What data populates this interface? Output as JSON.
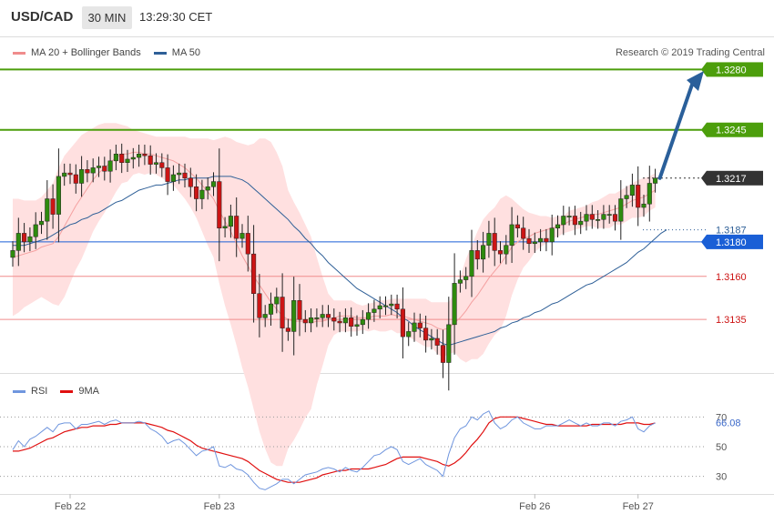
{
  "header": {
    "symbol": "USD/CAD",
    "timeframe": "30 MIN",
    "time": "13:29:30 CET"
  },
  "copyright": "Research © 2019 Trading Central",
  "colors": {
    "resistance": "#4c9e0c",
    "support_line": "#f08c8c",
    "ma50": "#2e5f97",
    "band_fill": "#ffe0e0",
    "ma20": "#f4a0a0",
    "bull_candle": "#2e8b0e",
    "bear_candle": "#cc1515",
    "rsi": "#7096de",
    "rsi_ma": "#e01010",
    "arrow": "#2a5f9a",
    "current_price_bg": "#333333",
    "pivot_bg": "#1a5fd6"
  },
  "chart_data": [
    {
      "type": "line",
      "title": "",
      "legend": [
        {
          "name": "MA 20 + Bollinger Bands",
          "color": "#f08c8c"
        },
        {
          "name": "MA 50",
          "color": "#2e5f97"
        }
      ],
      "legend_position": "top-left",
      "x_tick_labels": [
        "Feb 22",
        "Feb 23",
        "Feb 26",
        "Feb 27"
      ],
      "y_range": [
        1.3105,
        1.3295
      ],
      "levels": [
        {
          "value": 1.328,
          "label": "1.3280",
          "kind": "resistance"
        },
        {
          "value": 1.3245,
          "label": "1.3245",
          "kind": "resistance"
        },
        {
          "value": 1.3217,
          "label": "1.3217",
          "kind": "current"
        },
        {
          "value": 1.3187,
          "label": "1.3187",
          "kind": "ma50_value"
        },
        {
          "value": 1.318,
          "label": "1.3180",
          "kind": "pivot"
        },
        {
          "value": 1.316,
          "label": "1.3160",
          "kind": "support"
        },
        {
          "value": 1.3135,
          "label": "1.3135",
          "kind": "support"
        }
      ],
      "close": [
        1.3175,
        1.3185,
        1.318,
        1.3183,
        1.319,
        1.3192,
        1.3205,
        1.3196,
        1.3218,
        1.322,
        1.3219,
        1.3214,
        1.3222,
        1.322,
        1.3223,
        1.3224,
        1.3221,
        1.3227,
        1.3231,
        1.3226,
        1.3228,
        1.3229,
        1.3231,
        1.323,
        1.3225,
        1.3226,
        1.3223,
        1.3215,
        1.3219,
        1.322,
        1.3217,
        1.3212,
        1.3205,
        1.321,
        1.3212,
        1.3215,
        1.3188,
        1.3189,
        1.3195,
        1.3182,
        1.3185,
        1.3173,
        1.315,
        1.3136,
        1.3138,
        1.3144,
        1.3148,
        1.313,
        1.3128,
        1.3146,
        1.3135,
        1.3133,
        1.3136,
        1.3136,
        1.3138,
        1.3136,
        1.3134,
        1.3133,
        1.3136,
        1.3131,
        1.3132,
        1.3135,
        1.3139,
        1.3141,
        1.3143,
        1.3143,
        1.3144,
        1.3141,
        1.3125,
        1.3128,
        1.3133,
        1.313,
        1.3123,
        1.3124,
        1.312,
        1.311,
        1.3132,
        1.3156,
        1.3158,
        1.316,
        1.3175,
        1.317,
        1.3178,
        1.3185,
        1.3175,
        1.3173,
        1.3178,
        1.319,
        1.3188,
        1.3182,
        1.3179,
        1.318,
        1.3182,
        1.318,
        1.3188,
        1.319,
        1.3195,
        1.3195,
        1.319,
        1.3192,
        1.3196,
        1.3193,
        1.3193,
        1.3196,
        1.3196,
        1.3192,
        1.3205,
        1.3207,
        1.3213,
        1.32,
        1.3202,
        1.3214,
        1.3217
      ],
      "ma20": [
        1.3171,
        1.3172,
        1.3173,
        1.3174,
        1.3175,
        1.3177,
        1.3178,
        1.3179,
        1.3183,
        1.3189,
        1.3195,
        1.3201,
        1.3206,
        1.3211,
        1.3216,
        1.322,
        1.3223,
        1.3226,
        1.3229,
        1.3231,
        1.3231,
        1.3232,
        1.3232,
        1.3231,
        1.3231,
        1.323,
        1.3229,
        1.3228,
        1.3227,
        1.3225,
        1.3223,
        1.322,
        1.3217,
        1.3213,
        1.3209,
        1.3205,
        1.3198,
        1.3192,
        1.3186,
        1.3179,
        1.3172,
        1.3166,
        1.316,
        1.3155,
        1.315,
        1.3145,
        1.3141,
        1.3137,
        1.3135,
        1.3134,
        1.3134,
        1.3134,
        1.3133,
        1.3134,
        1.3134,
        1.3135,
        1.3136,
        1.3137,
        1.3137,
        1.3137,
        1.3136,
        1.3136,
        1.3136,
        1.3137,
        1.3137,
        1.3137,
        1.3138,
        1.3137,
        1.3137,
        1.3136,
        1.3135,
        1.3134,
        1.3133,
        1.3132,
        1.313,
        1.3129,
        1.313,
        1.3133,
        1.3136,
        1.314,
        1.3145,
        1.3149,
        1.3154,
        1.3159,
        1.3163,
        1.3167,
        1.3172,
        1.3177,
        1.318,
        1.3182,
        1.3183,
        1.3185,
        1.3186,
        1.3187,
        1.3188,
        1.3189,
        1.319,
        1.3192,
        1.3193,
        1.3194,
        1.3195,
        1.3196,
        1.3196,
        1.3197,
        1.3198,
        1.3199,
        1.32,
        1.3202,
        1.3204,
        1.3205,
        1.3206,
        1.3208,
        1.321
      ],
      "bb_upper": [
        1.3205,
        1.3205,
        1.3204,
        1.3204,
        1.3204,
        1.3206,
        1.321,
        1.3214,
        1.3223,
        1.323,
        1.3234,
        1.3238,
        1.3242,
        1.3244,
        1.3246,
        1.3248,
        1.3249,
        1.3249,
        1.3249,
        1.3248,
        1.3247,
        1.3245,
        1.3244,
        1.3243,
        1.3242,
        1.3241,
        1.3241,
        1.3241,
        1.3241,
        1.3241,
        1.3241,
        1.324,
        1.324,
        1.324,
        1.324,
        1.3239,
        1.324,
        1.3241,
        1.324,
        1.3238,
        1.3237,
        1.3236,
        1.3237,
        1.324,
        1.324,
        1.3238,
        1.3232,
        1.3224,
        1.321,
        1.3203,
        1.3197,
        1.319,
        1.3183,
        1.3171,
        1.316,
        1.315,
        1.3146,
        1.3146,
        1.3146,
        1.3146,
        1.3144,
        1.3143,
        1.3144,
        1.3145,
        1.3146,
        1.3146,
        1.3147,
        1.3147,
        1.3147,
        1.3147,
        1.3147,
        1.3147,
        1.3147,
        1.3145,
        1.3145,
        1.3145,
        1.3145,
        1.315,
        1.316,
        1.317,
        1.3178,
        1.3186,
        1.3193,
        1.3197,
        1.32,
        1.3205,
        1.3207,
        1.3205,
        1.3202,
        1.3199,
        1.3197,
        1.3196,
        1.3195,
        1.3195,
        1.3194,
        1.3195,
        1.3195,
        1.3198,
        1.3199,
        1.32,
        1.3201,
        1.3203,
        1.3204,
        1.3206,
        1.3208,
        1.3208,
        1.321,
        1.3212,
        1.3214,
        1.3216,
        1.3217,
        1.3218,
        1.322
      ],
      "bb_lower": [
        1.3137,
        1.3139,
        1.3142,
        1.3144,
        1.3146,
        1.3148,
        1.3146,
        1.3144,
        1.3143,
        1.3148,
        1.3156,
        1.3164,
        1.317,
        1.3178,
        1.3186,
        1.3192,
        1.3197,
        1.3203,
        1.3209,
        1.3214,
        1.3215,
        1.3219,
        1.322,
        1.3219,
        1.322,
        1.3219,
        1.3217,
        1.3215,
        1.3213,
        1.3209,
        1.3205,
        1.32,
        1.3194,
        1.3186,
        1.3178,
        1.3171,
        1.3156,
        1.3143,
        1.3132,
        1.312,
        1.3107,
        1.3096,
        1.3083,
        1.307,
        1.306,
        1.3052,
        1.305,
        1.305,
        1.306,
        1.3065,
        1.3071,
        1.3078,
        1.3083,
        1.3097,
        1.3108,
        1.312,
        1.3126,
        1.3128,
        1.3128,
        1.3128,
        1.3128,
        1.3129,
        1.3128,
        1.3129,
        1.3128,
        1.3128,
        1.3129,
        1.3127,
        1.3127,
        1.3125,
        1.3123,
        1.3121,
        1.3119,
        1.3119,
        1.3115,
        1.3113,
        1.3115,
        1.3116,
        1.3112,
        1.311,
        1.3112,
        1.3112,
        1.3115,
        1.3121,
        1.3126,
        1.3129,
        1.3137,
        1.3149,
        1.3158,
        1.3165,
        1.3169,
        1.3174,
        1.3177,
        1.3179,
        1.3182,
        1.3183,
        1.3185,
        1.3186,
        1.3187,
        1.3188,
        1.3189,
        1.3189,
        1.3188,
        1.3188,
        1.3188,
        1.319,
        1.319,
        1.3192,
        1.3194,
        1.3194,
        1.3195,
        1.3198,
        1.32
      ],
      "ma50": [
        1.3178,
        1.3178,
        1.3178,
        1.3179,
        1.318,
        1.3181,
        1.3182,
        1.3184,
        1.3186,
        1.3188,
        1.319,
        1.3191,
        1.3193,
        1.3194,
        1.3196,
        1.3197,
        1.3199,
        1.3201,
        1.3203,
        1.3204,
        1.3206,
        1.3208,
        1.321,
        1.3211,
        1.3212,
        1.3213,
        1.3213,
        1.3214,
        1.3215,
        1.3216,
        1.3216,
        1.3217,
        1.3217,
        1.3217,
        1.3217,
        1.3218,
        1.3218,
        1.3218,
        1.3218,
        1.3217,
        1.3216,
        1.3214,
        1.3211,
        1.3208,
        1.3205,
        1.3202,
        1.3199,
        1.3196,
        1.3193,
        1.3189,
        1.3186,
        1.3182,
        1.3179,
        1.3175,
        1.3172,
        1.3168,
        1.3165,
        1.3162,
        1.3159,
        1.3156,
        1.3153,
        1.3151,
        1.3149,
        1.3147,
        1.3145,
        1.3143,
        1.3141,
        1.3139,
        1.3136,
        1.3134,
        1.3131,
        1.3129,
        1.3127,
        1.3125,
        1.3123,
        1.3121,
        1.312,
        1.3121,
        1.3122,
        1.3123,
        1.3124,
        1.3125,
        1.3126,
        1.3127,
        1.3128,
        1.313,
        1.3131,
        1.3133,
        1.3134,
        1.3136,
        1.3137,
        1.3139,
        1.314,
        1.3142,
        1.3144,
        1.3145,
        1.3147,
        1.3149,
        1.3151,
        1.3153,
        1.3155,
        1.3156,
        1.3158,
        1.316,
        1.3162,
        1.3164,
        1.3166,
        1.3168,
        1.3171,
        1.3174,
        1.3176,
        1.3179,
        1.3182,
        1.3185,
        1.3187
      ]
    },
    {
      "type": "line",
      "title": "",
      "legend": [
        {
          "name": "RSI",
          "color": "#7096de"
        },
        {
          "name": "9MA",
          "color": "#e01010"
        }
      ],
      "legend_position": "top-left",
      "y_range": [
        20,
        80
      ],
      "y_ticks": [
        30,
        50,
        70
      ],
      "current_label": "66.08",
      "x_tick_labels": [
        "Feb 22",
        "Feb 23",
        "Feb 26",
        "Feb 27"
      ],
      "rsi": [
        48,
        54,
        50,
        55,
        57,
        60,
        63,
        60,
        65,
        66,
        66,
        62,
        65,
        65,
        66,
        67,
        65,
        67,
        68,
        66,
        66,
        66,
        67,
        66,
        62,
        60,
        57,
        52,
        54,
        55,
        52,
        48,
        44,
        47,
        48,
        50,
        37,
        36,
        38,
        35,
        34,
        31,
        26,
        22,
        21,
        23,
        25,
        28,
        28,
        25,
        28,
        31,
        32,
        33,
        35,
        36,
        35,
        33,
        36,
        34,
        33,
        36,
        40,
        44,
        45,
        48,
        50,
        48,
        40,
        38,
        40,
        42,
        38,
        36,
        34,
        30,
        45,
        56,
        62,
        64,
        70,
        68,
        72,
        74,
        66,
        62,
        64,
        68,
        70,
        66,
        64,
        62,
        62,
        64,
        64,
        64,
        66,
        68,
        66,
        64,
        66,
        64,
        64,
        66,
        66,
        64,
        67,
        68,
        70,
        62,
        60,
        64,
        66
      ],
      "rsi_9ma": [
        47,
        47,
        48,
        49,
        51,
        53,
        55,
        56,
        58,
        60,
        61,
        62,
        63,
        63,
        64,
        64,
        64,
        65,
        65,
        66,
        66,
        66,
        66,
        66,
        65,
        64,
        63,
        61,
        60,
        58,
        56,
        54,
        51,
        49,
        48,
        47,
        46,
        45,
        44,
        43,
        42,
        40,
        37,
        34,
        32,
        30,
        28,
        27,
        26,
        26,
        26,
        27,
        28,
        29,
        31,
        32,
        33,
        34,
        34,
        35,
        35,
        35,
        35,
        36,
        37,
        38,
        40,
        42,
        43,
        43,
        43,
        43,
        42,
        41,
        40,
        38,
        37,
        39,
        42,
        46,
        51,
        55,
        60,
        66,
        69,
        70,
        70,
        70,
        70,
        69,
        68,
        67,
        66,
        65,
        65,
        64,
        64,
        64,
        64,
        64,
        64,
        65,
        65,
        65,
        65,
        65,
        65,
        66,
        66,
        66,
        65,
        65,
        66
      ]
    }
  ]
}
